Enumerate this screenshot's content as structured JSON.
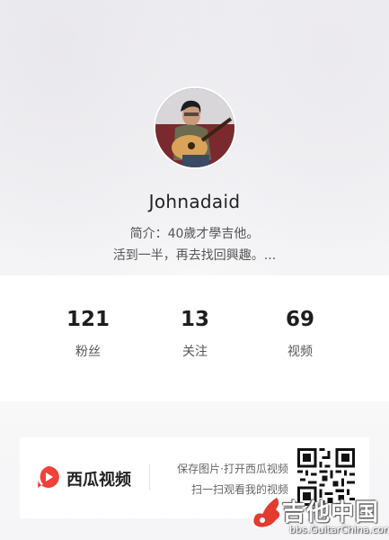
{
  "profile": {
    "username": "Johnadaid",
    "bio_line1": "简介：40歲才學吉他。",
    "bio_line2": "活到一半，再去找回興趣。..."
  },
  "stats": [
    {
      "value": "121",
      "label": "粉丝"
    },
    {
      "value": "13",
      "label": "关注"
    },
    {
      "value": "69",
      "label": "视频"
    }
  ],
  "footer": {
    "app_name": "西瓜视频",
    "promo_line1": "保存图片·打开西瓜视频",
    "promo_line2": "扫一扫观看我的视频"
  },
  "watermark": {
    "main": "吉他中国",
    "sub": "bbs.GuitarChina.com"
  },
  "colors": {
    "brand_red": "#f0413a"
  }
}
